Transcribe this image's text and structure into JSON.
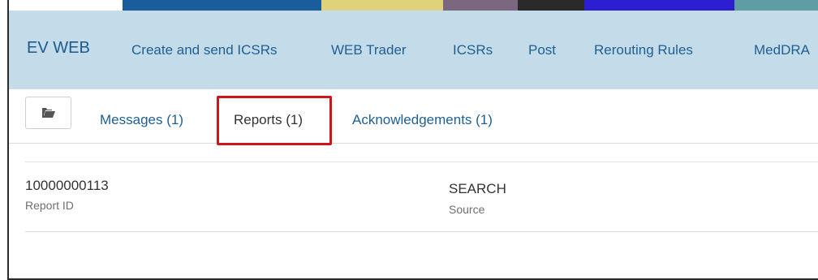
{
  "colors": {
    "navbar_bg": "#c4dbe9",
    "link": "#1f5f94",
    "highlight": "#d0141d",
    "strip": [
      "#1a5d9c",
      "#e0d27a",
      "#7b6780",
      "#2a2a2a",
      "#2b1fd1",
      "#5f9da4"
    ]
  },
  "nav": {
    "brand": "EV WEB",
    "items": [
      {
        "label": "Create and send ICSRs"
      },
      {
        "label": "WEB Trader"
      },
      {
        "label": "ICSRs"
      },
      {
        "label": "Post"
      },
      {
        "label": "Rerouting Rules"
      },
      {
        "label": "MedDRA"
      }
    ]
  },
  "toolbar": {
    "folder_icon": "folder-open-icon"
  },
  "tabs": [
    {
      "label": "Messages (1)",
      "active": false
    },
    {
      "label": "Reports (1)",
      "active": true
    },
    {
      "label": "Acknowledgements (1)",
      "active": false
    }
  ],
  "report": {
    "id_value": "10000000113",
    "id_label": "Report ID",
    "source_value": "SEARCH",
    "source_label": "Source"
  }
}
